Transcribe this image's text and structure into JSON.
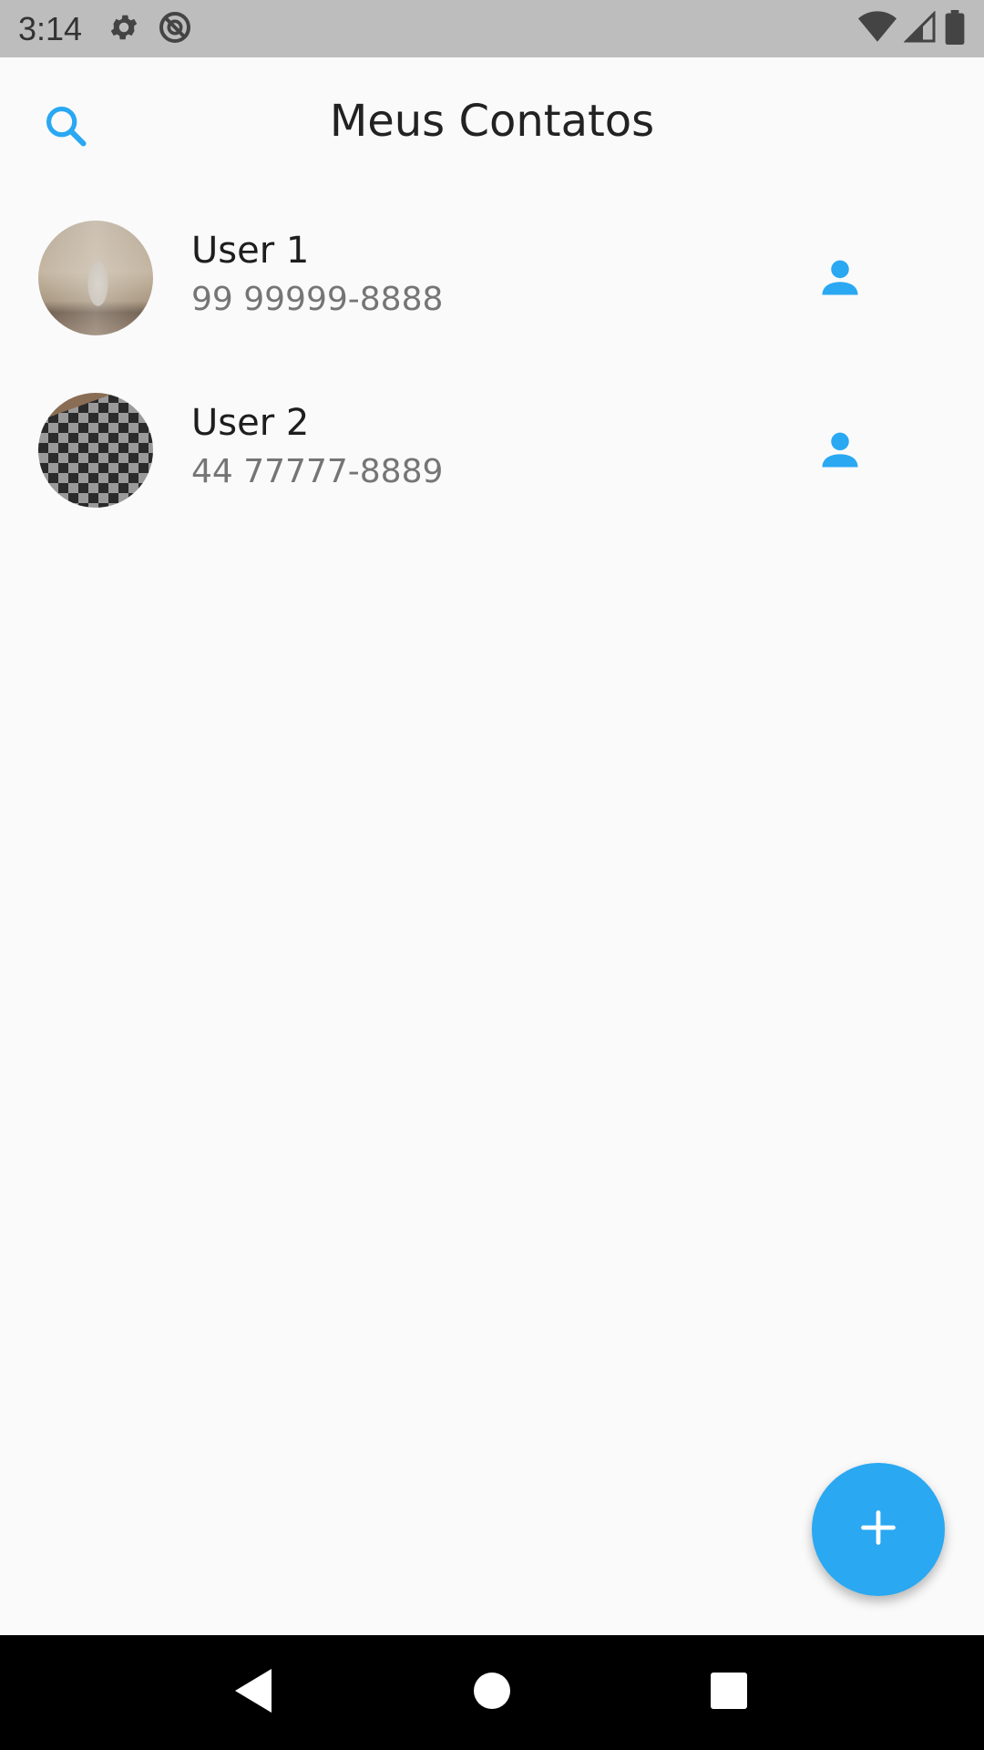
{
  "status_bar": {
    "time": "3:14",
    "icons": [
      "gear-icon",
      "do-not-disturb-icon",
      "wifi-icon",
      "signal-icon",
      "battery-icon"
    ]
  },
  "app_bar": {
    "title": "Meus Contatos",
    "search_icon": "search-icon"
  },
  "contacts": [
    {
      "name": "User 1",
      "phone": "99 99999-8888",
      "icon": "person-icon"
    },
    {
      "name": "User 2",
      "phone": "44 77777-8889",
      "icon": "person-icon"
    }
  ],
  "fab": {
    "icon": "plus-icon"
  },
  "nav_bar": {
    "icons": [
      "back-icon",
      "home-icon",
      "recents-icon"
    ]
  },
  "colors": {
    "accent": "#2aa8f2",
    "background": "#fafafa",
    "status_bar": "#bdbdbd",
    "nav_bar": "#000000"
  }
}
